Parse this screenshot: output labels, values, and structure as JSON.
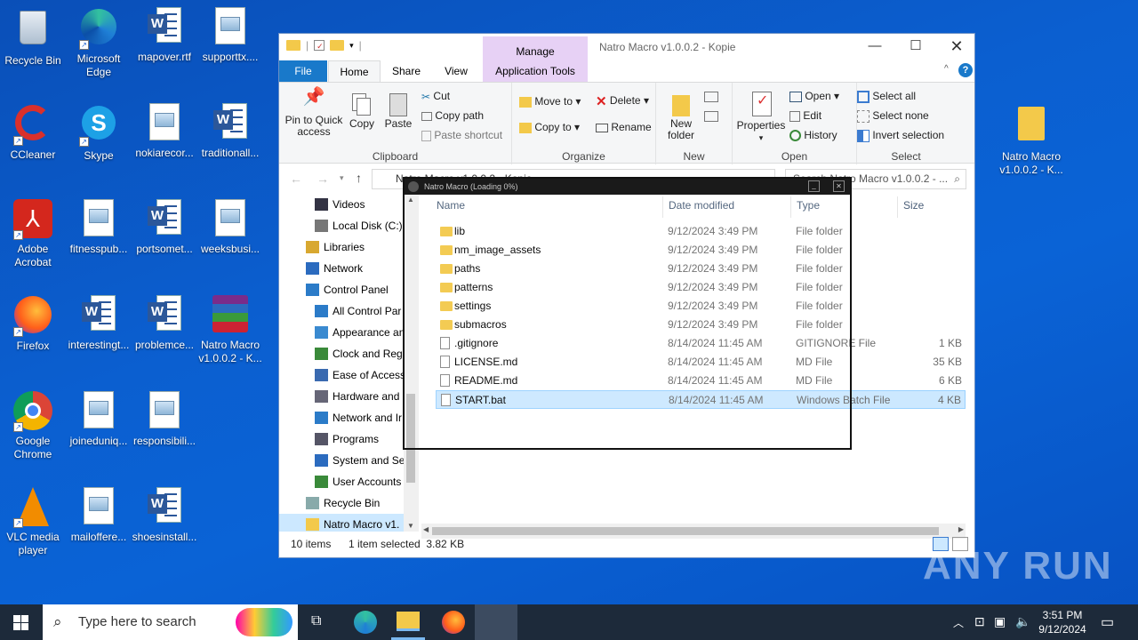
{
  "desktop": {
    "icons": [
      {
        "label": "Recycle Bin",
        "icon": "recycle-bin-icon"
      },
      {
        "label": "Microsoft Edge",
        "icon": "edge-icon"
      },
      {
        "label": "mapover.rtf",
        "icon": "word-doc-icon"
      },
      {
        "label": "supporttx....",
        "icon": "image-doc-icon"
      },
      {
        "label": "CCleaner",
        "icon": "ccleaner-icon"
      },
      {
        "label": "Skype",
        "icon": "skype-icon"
      },
      {
        "label": "nokiarecor...",
        "icon": "image-doc-icon"
      },
      {
        "label": "traditionall...",
        "icon": "word-doc-icon"
      },
      {
        "label": "Adobe Acrobat",
        "icon": "acrobat-icon"
      },
      {
        "label": "fitnesspub...",
        "icon": "image-doc-icon"
      },
      {
        "label": "portsomet...",
        "icon": "word-doc-icon"
      },
      {
        "label": "weeksbusi...",
        "icon": "image-doc-icon"
      },
      {
        "label": "Firefox",
        "icon": "firefox-icon"
      },
      {
        "label": "interestingt...",
        "icon": "word-doc-icon"
      },
      {
        "label": "problemce...",
        "icon": "word-doc-icon"
      },
      {
        "label": "Natro Macro v1.0.0.2 - K...",
        "icon": "winrar-icon"
      },
      {
        "label": "Google Chrome",
        "icon": "chrome-icon"
      },
      {
        "label": "joineduniq...",
        "icon": "image-doc-icon"
      },
      {
        "label": "responsibili...",
        "icon": "image-doc-icon"
      },
      {
        "label": "VLC media player",
        "icon": "vlc-icon"
      },
      {
        "label": "mailoffere...",
        "icon": "image-doc-icon"
      },
      {
        "label": "shoesinstall...",
        "icon": "word-doc-icon"
      },
      {
        "label": "Natro Macro v1.0.0.2 - K...",
        "icon": "folder-icon"
      }
    ]
  },
  "explorer": {
    "title": "Natro Macro v1.0.0.2 - Kopie",
    "manage_label": "Manage",
    "tabs": [
      "File",
      "Home",
      "Share",
      "View",
      "Application Tools"
    ],
    "ribbon": {
      "clipboard": {
        "pin": "Pin to Quick access",
        "copy": "Copy",
        "paste": "Paste",
        "cut": "Cut",
        "copy_path": "Copy path",
        "paste_shortcut": "Paste shortcut",
        "label": "Clipboard"
      },
      "organize": {
        "move_to": "Move to",
        "copy_to": "Copy to",
        "delete": "Delete",
        "rename": "Rename",
        "label": "Organize"
      },
      "new": {
        "new_folder": "New folder",
        "label": "New"
      },
      "open": {
        "properties": "Properties",
        "open": "Open",
        "edit": "Edit",
        "history": "History",
        "label": "Open"
      },
      "select": {
        "select_all": "Select all",
        "select_none": "Select none",
        "invert": "Invert selection",
        "label": "Select"
      }
    },
    "address": "Natro Macro v1.0.0.2 - Kopie",
    "search_placeholder": "Search Natro Macro v1.0.0.2 - ...",
    "tree": [
      "Videos",
      "Local Disk (C:)",
      "Libraries",
      "Network",
      "Control Panel",
      "All Control Par",
      "Appearance an",
      "Clock and Regi",
      "Ease of Access",
      "Hardware and",
      "Network and Ir",
      "Programs",
      "System and Se",
      "User Accounts",
      "Recycle Bin",
      "Natro Macro v1."
    ],
    "columns": {
      "name": "Name",
      "date": "Date modified",
      "type": "Type",
      "size": "Size"
    },
    "files": [
      {
        "name": "lib",
        "date": "9/12/2024 3:49 PM",
        "type": "File folder",
        "size": "",
        "kind": "folder"
      },
      {
        "name": "nm_image_assets",
        "date": "9/12/2024 3:49 PM",
        "type": "File folder",
        "size": "",
        "kind": "folder"
      },
      {
        "name": "paths",
        "date": "9/12/2024 3:49 PM",
        "type": "File folder",
        "size": "",
        "kind": "folder"
      },
      {
        "name": "patterns",
        "date": "9/12/2024 3:49 PM",
        "type": "File folder",
        "size": "",
        "kind": "folder"
      },
      {
        "name": "settings",
        "date": "9/12/2024 3:49 PM",
        "type": "File folder",
        "size": "",
        "kind": "folder"
      },
      {
        "name": "submacros",
        "date": "9/12/2024 3:49 PM",
        "type": "File folder",
        "size": "",
        "kind": "folder"
      },
      {
        "name": ".gitignore",
        "date": "8/14/2024 11:45 AM",
        "type": "GITIGNORE File",
        "size": "1 KB",
        "kind": "file"
      },
      {
        "name": "LICENSE.md",
        "date": "8/14/2024 11:45 AM",
        "type": "MD File",
        "size": "35 KB",
        "kind": "file"
      },
      {
        "name": "README.md",
        "date": "8/14/2024 11:45 AM",
        "type": "MD File",
        "size": "6 KB",
        "kind": "file"
      },
      {
        "name": "START.bat",
        "date": "8/14/2024 11:45 AM",
        "type": "Windows Batch File",
        "size": "4 KB",
        "kind": "file",
        "selected": true
      }
    ],
    "status": {
      "count": "10 items",
      "selected": "1 item selected  3.82 KB"
    }
  },
  "loading": {
    "title": "Natro Macro (Loading 0%)"
  },
  "taskbar": {
    "search_placeholder": "Type here to search",
    "time": "3:51 PM",
    "date": "9/12/2024"
  },
  "watermark": "ANY RUN"
}
